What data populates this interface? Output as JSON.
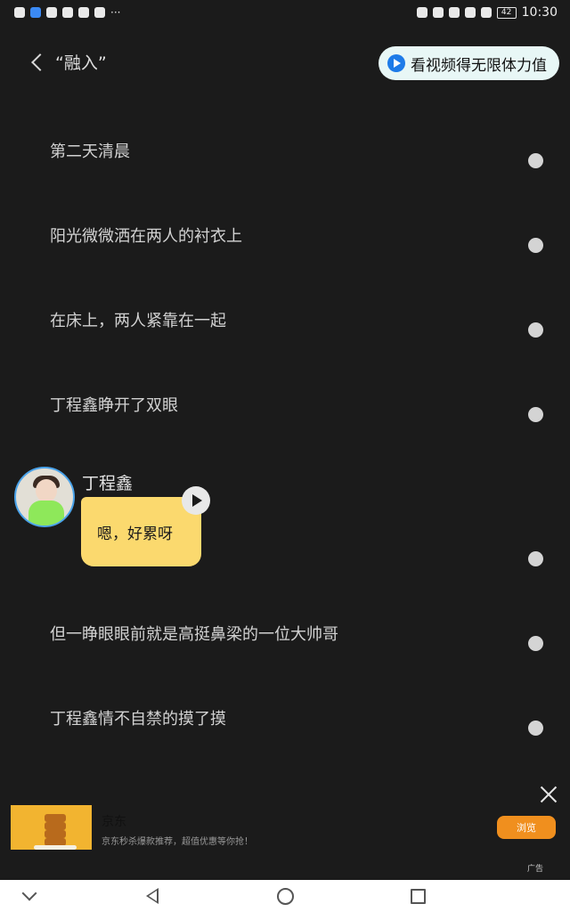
{
  "status_bar": {
    "time": "10:30",
    "battery": "42",
    "more": "···"
  },
  "header": {
    "back_title": "“融入”",
    "reward_label": "看视频得无限体力值"
  },
  "story_lines": [
    "第二天清晨",
    "阳光微微洒在两人的衬衣上",
    "在床上，两人紧靠在一起",
    "丁程鑫睁开了双眼"
  ],
  "chat": {
    "speaker": "丁程鑫",
    "message": "嗯，好累呀"
  },
  "story_lines_after": [
    "但一睁眼眼前就是高挺鼻梁的一位大帅哥",
    "丁程鑫情不自禁的摸了摸"
  ],
  "ad": {
    "brand": "京东",
    "description": "京东秒杀爆款推荐，超值优惠等你抢！",
    "button": "浏览",
    "tag": "广告"
  }
}
